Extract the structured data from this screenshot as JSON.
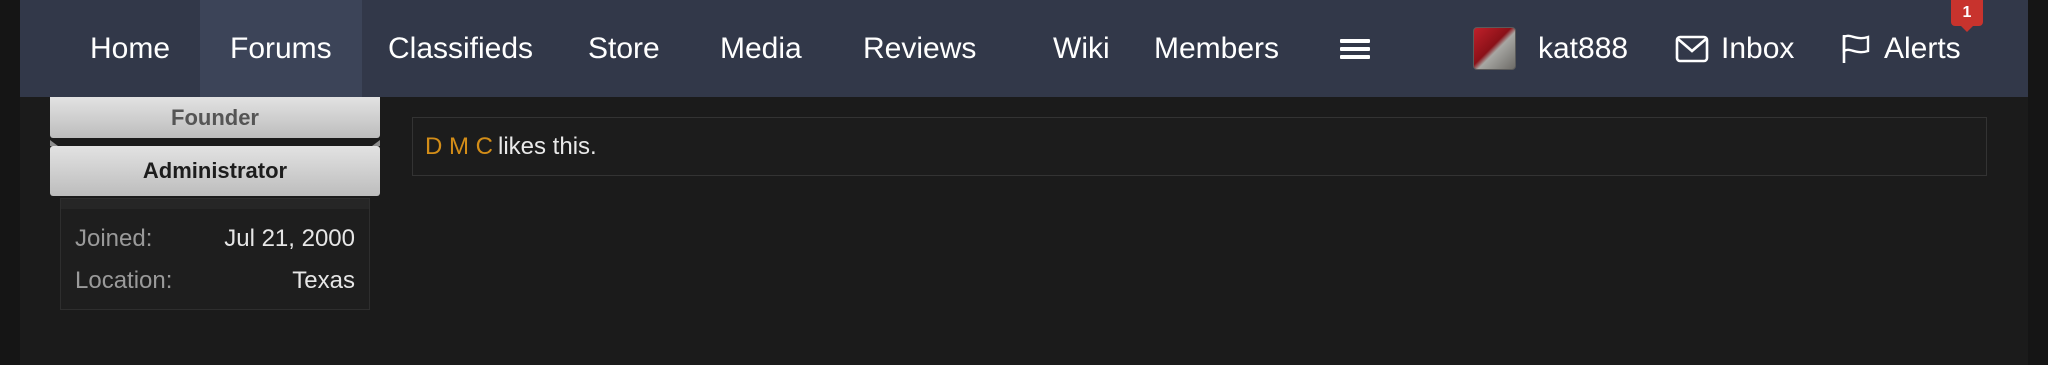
{
  "nav": {
    "items": [
      {
        "label": "Home"
      },
      {
        "label": "Forums"
      },
      {
        "label": "Classifieds"
      },
      {
        "label": "Store"
      },
      {
        "label": "Media"
      },
      {
        "label": "Reviews"
      },
      {
        "label": "Wiki"
      },
      {
        "label": "Members"
      }
    ],
    "more_icon": "hamburger-icon",
    "account": {
      "username": "kat888"
    },
    "inbox": {
      "label": "Inbox",
      "icon": "envelope-icon"
    },
    "alerts": {
      "label": "Alerts",
      "icon": "flag-icon",
      "count": "1"
    },
    "active_item": "Forums"
  },
  "user_panel": {
    "titles": [
      "Founder",
      "Administrator"
    ],
    "stats": [
      {
        "key": "Joined:",
        "value": "Jul 21, 2000"
      },
      {
        "key": "Location:",
        "value": "Texas"
      }
    ]
  },
  "post": {
    "likes": {
      "user": "D M C",
      "text": "likes this."
    }
  },
  "colors": {
    "nav_bg": "#323849",
    "nav_active_bg": "#3c4458",
    "page_bg": "#1b1b1b",
    "link_accent": "#d38d18",
    "badge_red": "#c8332d"
  }
}
